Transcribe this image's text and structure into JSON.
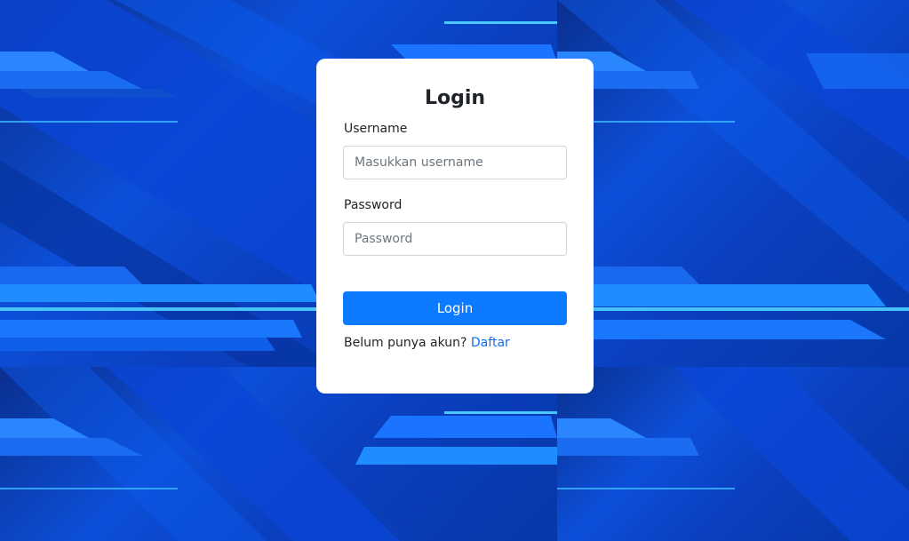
{
  "background": {
    "description_icon": "abstract-blue-stripes-background",
    "colors": {
      "base": "#0a3fc4",
      "light_stripe": "#1f8cff",
      "dark_stripe": "#062b82",
      "glow": "#4fd2ff"
    }
  },
  "login_card": {
    "title": "Login",
    "username": {
      "label": "Username",
      "placeholder": "Masukkan username",
      "value": ""
    },
    "password": {
      "label": "Password",
      "placeholder": "Password",
      "value": ""
    },
    "submit_label": "Login",
    "signup_prompt": "Belum punya akun?",
    "signup_link": "Daftar",
    "colors": {
      "button": "#0d7bff",
      "link": "#0d6efd"
    }
  }
}
